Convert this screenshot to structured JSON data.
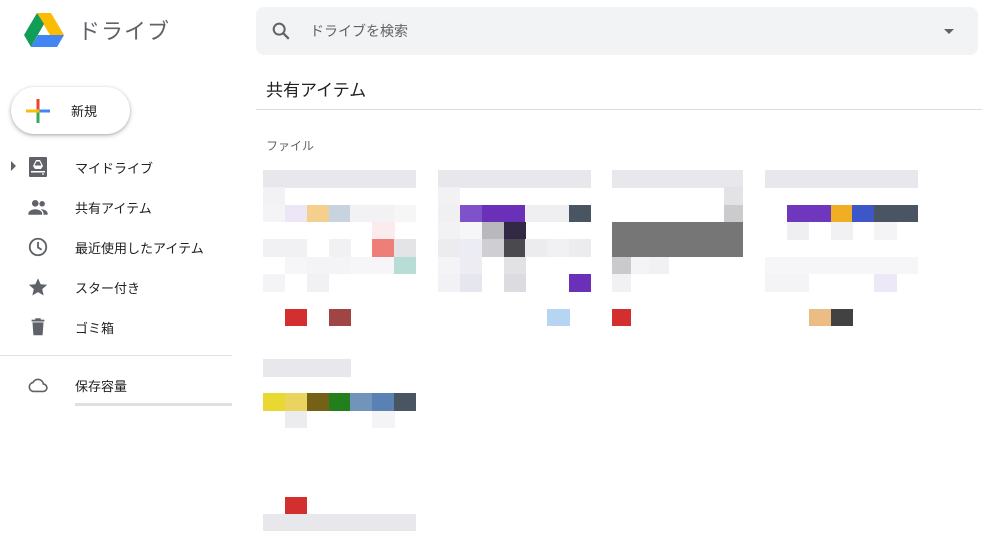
{
  "app": {
    "title": "ドライブ",
    "logo_icon": "google-drive-logo",
    "logo_colors": [
      "#0f9d58",
      "#fbbc04",
      "#4285f4"
    ]
  },
  "sidebar": {
    "new_button": {
      "label": "新規",
      "icon": "plus-icon",
      "plus_colors": [
        "#ea4335",
        "#34a853",
        "#4285f4",
        "#fbbc04"
      ]
    },
    "items": [
      {
        "label": "マイドライブ",
        "icon": "my-drive-icon",
        "has_caret": true
      },
      {
        "label": "共有アイテム",
        "icon": "people-icon"
      },
      {
        "label": "最近使用したアイテム",
        "icon": "clock-icon"
      },
      {
        "label": "スター付き",
        "icon": "star-icon"
      },
      {
        "label": "ゴミ箱",
        "icon": "trash-icon"
      }
    ],
    "storage": {
      "label": "保存容量",
      "icon": "cloud-icon"
    }
  },
  "search": {
    "placeholder": "ドライブを検索",
    "value": "",
    "icon": "search-icon",
    "options_icon": "dropdown-arrow-icon"
  },
  "main": {
    "title": "共有アイテム",
    "section_label": "ファイル"
  },
  "colors": {
    "icon_gray": "#5f6368",
    "search_bg": "#f1f3f4",
    "divider": "#e0e0e0"
  },
  "file_thumbnails": [
    {
      "name": "file-thumbnail-1",
      "rows": [
        [
          "e8e8ec",
          "e8e8ec",
          "e8e8ec",
          "e8e8ec",
          "e8e8ec",
          "e8e8ec",
          "e8e8ec"
        ],
        [
          "f2f2f4",
          "ffffff",
          "ffffff",
          "ffffff",
          "ffffff",
          "ffffff",
          "ffffff"
        ],
        [
          "f4f4f6",
          "ece6f6",
          "f5cf8e",
          "c7d3de",
          "f2f2f4",
          "f2f2f4",
          "f6f6f7"
        ],
        [
          "ffffff",
          "ffffff",
          "ffffff",
          "ffffff",
          "ffffff",
          "faecec",
          "ffffff"
        ],
        [
          "f1f1f3",
          "f1f1f3",
          "ffffff",
          "f1f1f3",
          "ffffff",
          "ee7f78",
          "e4e4e6"
        ],
        [
          "ffffff",
          "f6f6f8",
          "f4f4f6",
          "f4f4f6",
          "f6f6f8",
          "f6f6f8",
          "b8dcd6"
        ],
        [
          "f4f4f6",
          "ffffff",
          "f1f1f3",
          "ffffff",
          "ffffff",
          "ffffff",
          "ffffff"
        ],
        [
          "ffffff",
          "ffffff",
          "ffffff",
          "ffffff",
          "ffffff",
          "ffffff",
          "ffffff"
        ],
        [
          "ffffff",
          "d32f2f",
          "ffffff",
          "a04545",
          "ffffff",
          "ffffff",
          "ffffff"
        ]
      ]
    },
    {
      "name": "file-thumbnail-2",
      "rows": [
        [
          "e8e8ec",
          "e8e8ec",
          "e8e8ec",
          "e8e8ec",
          "e8e8ec",
          "e8e8ec",
          "e8e8ec"
        ],
        [
          "f2f2f4",
          "ffffff",
          "ffffff",
          "ffffff",
          "ffffff",
          "ffffff",
          "ffffff"
        ],
        [
          "f0f0f2",
          "7e52c8",
          "6a30b8",
          "6a30b8",
          "efeff1",
          "efeff1",
          "4a5563"
        ],
        [
          "f2f2f4",
          "f6f6f8",
          "b9b9bd",
          "322a44",
          "ffffff",
          "ffffff",
          "ffffff"
        ],
        [
          "ececef",
          "ececf4",
          "cfcfd3",
          "4a4a4e",
          "ececef",
          "f1f1f3",
          "ececef"
        ],
        [
          "f4f4f6",
          "ececf2",
          "ffffff",
          "e2e2e4",
          "ffffff",
          "ffffff",
          "ffffff"
        ],
        [
          "f2f2f6",
          "e6e6ee",
          "ffffff",
          "dcdce0",
          "ffffff",
          "ffffff",
          "6a30b8"
        ],
        [
          "ffffff",
          "ffffff",
          "ffffff",
          "ffffff",
          "ffffff",
          "ffffff",
          "ffffff"
        ],
        [
          "ffffff",
          "ffffff",
          "ffffff",
          "ffffff",
          "ffffff",
          "b5d5f2",
          "ffffff"
        ]
      ]
    },
    {
      "name": "file-thumbnail-3",
      "rows": [
        [
          "e8e8ec",
          "e8e8ec",
          "e8e8ec",
          "e8e8ec",
          "e8e8ec",
          "e8e8ec",
          "e8e8ec"
        ],
        [
          "ffffff",
          "ffffff",
          "ffffff",
          "ffffff",
          "ffffff",
          "ffffff",
          "e3e3e5"
        ],
        [
          "ffffff",
          "ffffff",
          "ffffff",
          "ffffff",
          "ffffff",
          "ffffff",
          "cbcbcd"
        ],
        [
          "767676",
          "767676",
          "767676",
          "767676",
          "767676",
          "767676",
          "767676"
        ],
        [
          "767676",
          "767676",
          "767676",
          "767676",
          "767676",
          "767676",
          "767676"
        ],
        [
          "cacacc",
          "f4f4f6",
          "f1f1f3",
          "ffffff",
          "ffffff",
          "ffffff",
          "ffffff"
        ],
        [
          "f1f1f3",
          "ffffff",
          "ffffff",
          "ffffff",
          "ffffff",
          "ffffff",
          "ffffff"
        ],
        [
          "ffffff",
          "ffffff",
          "ffffff",
          "ffffff",
          "ffffff",
          "ffffff",
          "ffffff"
        ],
        [
          "d32f2f",
          "ffffff",
          "ffffff",
          "ffffff",
          "ffffff",
          "ffffff",
          "ffffff"
        ]
      ]
    },
    {
      "name": "file-thumbnail-4",
      "rows": [
        [
          "e8e8ec",
          "e8e8ec",
          "e8e8ec",
          "e8e8ec",
          "e8e8ec",
          "e8e8ec",
          "e8e8ec"
        ],
        [
          "ffffff",
          "ffffff",
          "ffffff",
          "ffffff",
          "ffffff",
          "ffffff",
          "ffffff"
        ],
        [
          "ffffff",
          "6e37be",
          "6e37be",
          "f0ae24",
          "3d57c9",
          "4a5563",
          "4a5563"
        ],
        [
          "ffffff",
          "efeff1",
          "ffffff",
          "f1f1f3",
          "ffffff",
          "f4f4f6",
          "ffffff"
        ],
        [
          "ffffff",
          "ffffff",
          "ffffff",
          "ffffff",
          "ffffff",
          "ffffff",
          "ffffff"
        ],
        [
          "f6f6f8",
          "f6f6f8",
          "f6f6f8",
          "f6f6f8",
          "f6f6f8",
          "f6f6f8",
          "f6f6f8"
        ],
        [
          "f4f4f6",
          "f4f4f6",
          "ffffff",
          "ffffff",
          "ffffff",
          "ece8f8",
          "ffffff"
        ],
        [
          "ffffff",
          "ffffff",
          "ffffff",
          "ffffff",
          "ffffff",
          "ffffff",
          "ffffff"
        ],
        [
          "ffffff",
          "ffffff",
          "ebbd85",
          "424242",
          "ffffff",
          "ffffff",
          "ffffff"
        ]
      ]
    },
    {
      "name": "file-thumbnail-5",
      "rows": [
        [
          "e8e8ec",
          "e8e8ec",
          "e8e8ec",
          "e8e8ec",
          "ffffff",
          "ffffff",
          "ffffff"
        ],
        [
          "ffffff",
          "ffffff",
          "ffffff",
          "ffffff",
          "ffffff",
          "ffffff",
          "ffffff"
        ],
        [
          "e8d831",
          "ead460",
          "746116",
          "237f1c",
          "7394ba",
          "5a81b3",
          "4a5563"
        ],
        [
          "ffffff",
          "ececef",
          "ffffff",
          "ffffff",
          "ffffff",
          "f4f4f6",
          "ffffff"
        ],
        [
          "ffffff",
          "ffffff",
          "ffffff",
          "ffffff",
          "ffffff",
          "ffffff",
          "ffffff"
        ],
        [
          "ffffff",
          "ffffff",
          "ffffff",
          "ffffff",
          "ffffff",
          "ffffff",
          "ffffff"
        ],
        [
          "ffffff",
          "ffffff",
          "ffffff",
          "ffffff",
          "ffffff",
          "ffffff",
          "ffffff"
        ],
        [
          "ffffff",
          "ffffff",
          "ffffff",
          "ffffff",
          "ffffff",
          "ffffff",
          "ffffff"
        ],
        [
          "ffffff",
          "d32f2f",
          "ffffff",
          "ffffff",
          "ffffff",
          "ffffff",
          "ffffff"
        ],
        [
          "e8e8ec",
          "e8e8ec",
          "e8e8ec",
          "e8e8ec",
          "e8e8ec",
          "e8e8ec",
          "e8e8ec"
        ]
      ]
    }
  ]
}
